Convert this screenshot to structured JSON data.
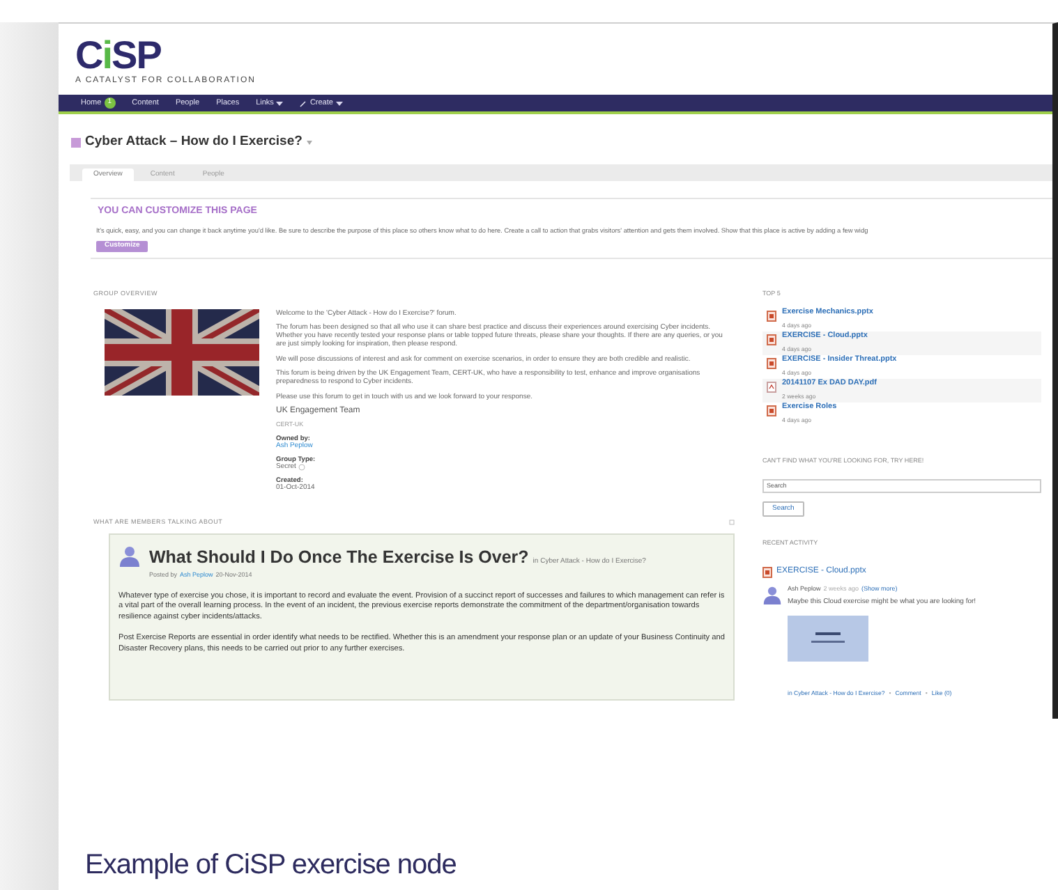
{
  "logo": {
    "parts": [
      "C",
      "i",
      "SP"
    ],
    "tagline": "A CATALYST FOR COLLABORATION"
  },
  "nav": [
    {
      "kind": "link",
      "label": "Home",
      "badge": "1"
    },
    {
      "kind": "link",
      "label": "Content"
    },
    {
      "kind": "link",
      "label": "People"
    },
    {
      "kind": "link",
      "label": "Places"
    },
    {
      "kind": "menu",
      "label": "Links"
    },
    {
      "kind": "create",
      "label": "Create"
    }
  ],
  "place_title": "Cyber Attack – How do I Exercise?",
  "tabs": [
    {
      "label": "Overview",
      "selected": true
    },
    {
      "label": "Content",
      "selected": false
    },
    {
      "label": "People",
      "selected": false
    }
  ],
  "customize": {
    "heading": "YOU CAN CUSTOMIZE THIS PAGE",
    "text": "It's quick, easy, and you can change it back anytime you'd like. Be sure to describe the purpose of this place so others know what to do here. Create a call to action that grabs visitors' attention and gets them involved. Show that this place is active by adding a few widg",
    "button": "Customize"
  },
  "group_overview": {
    "heading": "GROUP OVERVIEW",
    "image": {
      "kind": "picture"
    },
    "paragraphs": [
      "Welcome to the 'Cyber Attack - How do I Exercise?' forum.",
      "The forum has been designed so that all who use it can share best practice and discuss their experiences around exercising Cyber incidents. Whether you have recently tested your response plans or table topped future threats, please share your thoughts. If there are any queries, or you are just simply looking for inspiration, then please respond.",
      "We will pose discussions of interest and ask for comment on exercise scenarios, in order to ensure they are both credible and realistic.",
      "This forum is being driven by the UK Engagement Team, CERT-UK, who have a responsibility to test, enhance and improve organisations preparedness to respond to Cyber incidents.",
      "Please use this forum to get in touch with us and we look forward to your response."
    ],
    "signature": "UK Engagement Team",
    "team": "CERT-UK",
    "fields": [
      {
        "kind": "link",
        "label": "Owned by:",
        "value": "Ash Peplow"
      },
      {
        "kind": "info",
        "label": "Group Type:",
        "value": "Secret"
      },
      {
        "kind": "text",
        "label": "Created:",
        "value": "01-Oct-2014"
      }
    ]
  },
  "top5": {
    "heading": "TOP 5",
    "items": [
      {
        "kind": "ppt",
        "name": "Exercise Mechanics.pptx",
        "time": "4 days ago"
      },
      {
        "kind": "ppt",
        "name": "EXERCISE - Cloud.pptx",
        "time": "4 days ago"
      },
      {
        "kind": "ppt",
        "name": "EXERCISE - Insider Threat.pptx",
        "time": "4 days ago"
      },
      {
        "kind": "pdf",
        "name": "20141107 Ex DAD DAY.pdf",
        "time": "2 weeks ago"
      },
      {
        "kind": "ppt",
        "name": "Exercise Roles",
        "time": "4 days ago"
      }
    ]
  },
  "search": {
    "heading": "CAN'T FIND WHAT YOU'RE LOOKING FOR, TRY HERE!",
    "placeholder": "Search",
    "button": "Search"
  },
  "recent_activity": {
    "heading": "RECENT ACTIVITY",
    "item": {
      "kind": "ppt",
      "title": "EXERCISE - Cloud.pptx",
      "author": "Ash Peplow",
      "time": "2 weeks ago",
      "more": "(Show more)",
      "comment": "Maybe this Cloud exercise might be what you are looking for!",
      "place": "in Cyber Attack - How do I Exercise?",
      "actions": [
        {
          "separator": "•",
          "label": "Comment"
        },
        {
          "separator": "•",
          "label": "Like (0)"
        }
      ]
    }
  },
  "discussion": {
    "heading": "WHAT ARE MEMBERS TALKING ABOUT",
    "title": "What Should I Do Once The Exercise Is Over?",
    "place": "in Cyber Attack - How do I Exercise?",
    "posted_by": "Posted by",
    "author": "Ash Peplow",
    "date": "20-Nov-2014",
    "paragraphs": [
      "Whatever type of exercise you chose, it is important to record and evaluate the event. Provision of a succinct report of successes and failures to which management can refer is a vital part of the overall learning process. In the event of an incident, the previous exercise reports demonstrate the commitment of the department/organisation towards resilience against cyber incidents/attacks.",
      "Post Exercise Reports are essential in order identify what needs to be rectified. Whether this is an amendment your response plan or an update of your Business Continuity and Disaster Recovery plans, this needs to be carried out prior to any further exercises."
    ]
  },
  "caption": "Example of CiSP exercise node"
}
